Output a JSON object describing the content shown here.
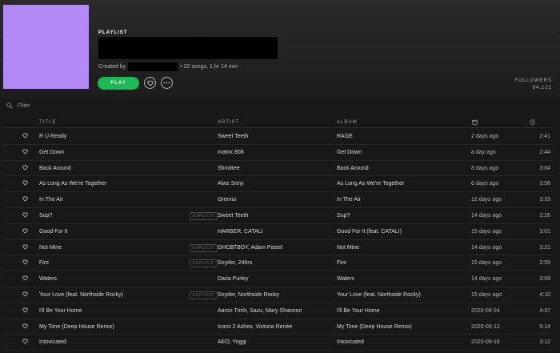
{
  "playlist": {
    "type_label": "PLAYLIST",
    "created_by_prefix": "Created by",
    "summary": "• 22 songs, 1 hr 14 min",
    "play_label": "PLAY",
    "followers_label": "FOLLOWERS",
    "followers_count": "84,122",
    "cover_color": "#b38af5"
  },
  "filter": {
    "placeholder": "Filter"
  },
  "columns": {
    "title": "TITLE",
    "artist": "ARTIST",
    "album": "ALBUM"
  },
  "colors": {
    "accent": "#1db954",
    "background": "#181818"
  },
  "tracks": [
    {
      "title": "R U Ready",
      "explicit": "",
      "artist": "Sweet Teeth",
      "album": "RAGE",
      "added": "2 days ago",
      "duration": "2:41"
    },
    {
      "title": "Get Down",
      "explicit": "",
      "artist": "matrix 808",
      "album": "Get Down",
      "added": "a day ago",
      "duration": "2:44"
    },
    {
      "title": "Back Around",
      "explicit": "",
      "artist": "Shmittee",
      "album": "Back Around",
      "added": "8 days ago",
      "duration": "3:04"
    },
    {
      "title": "As Long As We're Together",
      "explicit": "",
      "artist": "Alwz Snny",
      "album": "As Long As We're Together",
      "added": "6 days ago",
      "duration": "3:56"
    },
    {
      "title": "In The Air",
      "explicit": "",
      "artist": "Grenno",
      "album": "In The Air",
      "added": "12 days ago",
      "duration": "3:33"
    },
    {
      "title": "Sup?",
      "explicit": "EXPLICIT",
      "artist": "Sweet Teeth",
      "album": "Sup?",
      "added": "14 days ago",
      "duration": "2:26"
    },
    {
      "title": "Good For It",
      "explicit": "",
      "artist": "HARBER, CATALI",
      "album": "Good For It (feat. CATALI)",
      "added": "15 days ago",
      "duration": "3:01"
    },
    {
      "title": "Not Mine",
      "explicit": "EXPLICIT",
      "artist": "GHO$TBOY, Adam Pastel",
      "album": "Not Mine",
      "added": "14 days ago",
      "duration": "3:21"
    },
    {
      "title": "Fire",
      "explicit": "EXPLICIT",
      "artist": "Snyder, 24hrs",
      "album": "Fire",
      "added": "15 days ago",
      "duration": "2:59"
    },
    {
      "title": "Waters",
      "explicit": "",
      "artist": "Daria Purley",
      "album": "Waters",
      "added": "14 days ago",
      "duration": "3:09"
    },
    {
      "title": "Your Love (feat. Northside Rocky)",
      "explicit": "EXPLICIT",
      "artist": "Snyder, Northside Rocky",
      "album": "Your Love (feat. Northside Rocky)",
      "added": "15 days ago",
      "duration": "4:10"
    },
    {
      "title": "I'll Be Your Home",
      "explicit": "",
      "artist": "Aaron Trinh, Sazu, Mary Shannon",
      "album": "I'll Be Your Home",
      "added": "2020-09-24",
      "duration": "4:37"
    },
    {
      "title": "My Time (Deep House Remix)",
      "explicit": "",
      "artist": "Icons 2 Ashes, Victoria Renée",
      "album": "My Time (Deep House Remix)",
      "added": "2020-09-12",
      "duration": "5:14"
    },
    {
      "title": "Intoxicated",
      "explicit": "",
      "artist": "AEO, Yoggi",
      "album": "Intoxicated",
      "added": "2020-09-16",
      "duration": "3:12"
    }
  ]
}
